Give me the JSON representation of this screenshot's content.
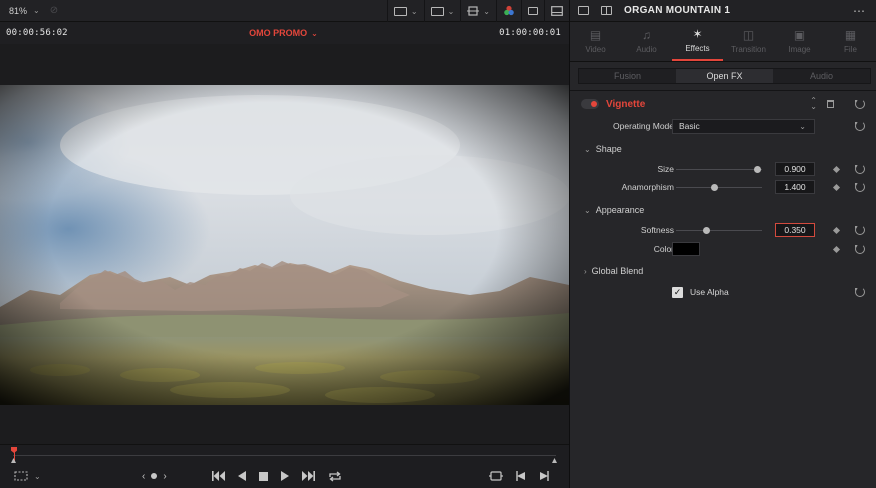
{
  "viewer": {
    "zoom": "81%",
    "timecode_left": "00:00:56:02",
    "timeline_name": "OMO PROMO",
    "timecode_right": "01:00:00:01"
  },
  "inspector": {
    "clip_title": "ORGAN MOUNTAIN 1",
    "tabs": [
      {
        "label": "Video",
        "icon": "film-icon",
        "glyph": "▤",
        "active": false
      },
      {
        "label": "Audio",
        "icon": "music-note-icon",
        "glyph": "♫",
        "active": false
      },
      {
        "label": "Effects",
        "icon": "magic-wand-icon",
        "glyph": "✶",
        "active": true
      },
      {
        "label": "Transition",
        "icon": "transition-icon",
        "glyph": "◫",
        "active": false
      },
      {
        "label": "Image",
        "icon": "image-icon",
        "glyph": "▣",
        "active": false
      },
      {
        "label": "File",
        "icon": "file-icon",
        "glyph": "▦",
        "active": false
      }
    ],
    "subtabs": [
      "Fusion",
      "Open FX",
      "Audio"
    ],
    "active_subtab": "Open FX",
    "effect": {
      "name": "Vignette",
      "enabled": true,
      "operating_mode_label": "Operating Mode",
      "operating_mode_value": "Basic",
      "shape_section": "Shape",
      "size_label": "Size",
      "size_value": "0.900",
      "size_fraction": 0.95,
      "anamorphism_label": "Anamorphism",
      "anamorphism_value": "1.400",
      "anamorphism_fraction": 0.45,
      "appearance_section": "Appearance",
      "softness_label": "Softness",
      "softness_value": "0.350",
      "softness_fraction": 0.35,
      "color_label": "Color",
      "color_value": "#000000",
      "global_blend_section": "Global Blend",
      "use_alpha_label": "Use Alpha",
      "use_alpha_checked": true
    }
  },
  "colors": {
    "accent": "#e4463b",
    "panel_bg": "#262629",
    "viewer_bg": "#1c1c1e"
  }
}
